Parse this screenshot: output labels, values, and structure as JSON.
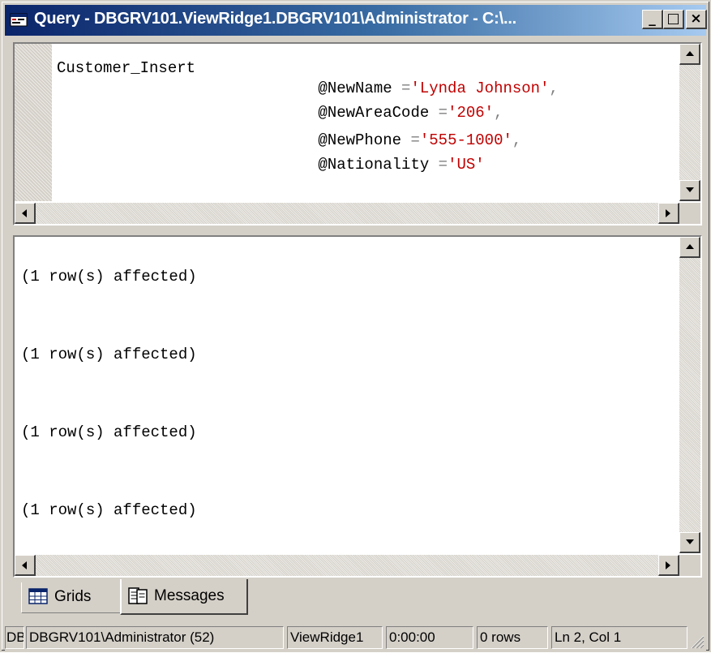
{
  "window": {
    "title": "Query - DBGRV101.ViewRidge1.DBGRV101\\Administrator - C:\\...",
    "minimize_label": "_",
    "maximize_label": "□",
    "close_label": "×"
  },
  "query": {
    "procedure": "Customer_Insert",
    "params": [
      {
        "name": "@NewName",
        "op": "=",
        "value": "'Lynda Johnson'",
        "sep": ","
      },
      {
        "name": "@NewAreaCode",
        "op": "=",
        "value": "'206'",
        "sep": ","
      },
      {
        "name": "@NewPhone",
        "op": "=",
        "value": "'555-1000'",
        "sep": ","
      },
      {
        "name": "@Nationality",
        "op": "=",
        "value": "'US'",
        "sep": ""
      }
    ]
  },
  "messages": {
    "lines": [
      "(1 row(s) affected)",
      "(1 row(s) affected)",
      "(1 row(s) affected)",
      "(1 row(s) affected)"
    ]
  },
  "tabs": {
    "grids": "Grids",
    "messages": "Messages"
  },
  "status": {
    "db": "DB",
    "connection": "DBGRV101\\Administrator (52)",
    "database": "ViewRidge1",
    "elapsed": "0:00:00",
    "rows": "0 rows",
    "position": "Ln 2, Col 1"
  },
  "icons": {
    "title": "query-window-icon",
    "grids": "grid-icon",
    "messages": "messages-icon"
  },
  "colors": {
    "title_start": "#0a246a",
    "title_end": "#a6caf0",
    "string_literal": "#c00000",
    "chrome": "#d4d0c8"
  }
}
